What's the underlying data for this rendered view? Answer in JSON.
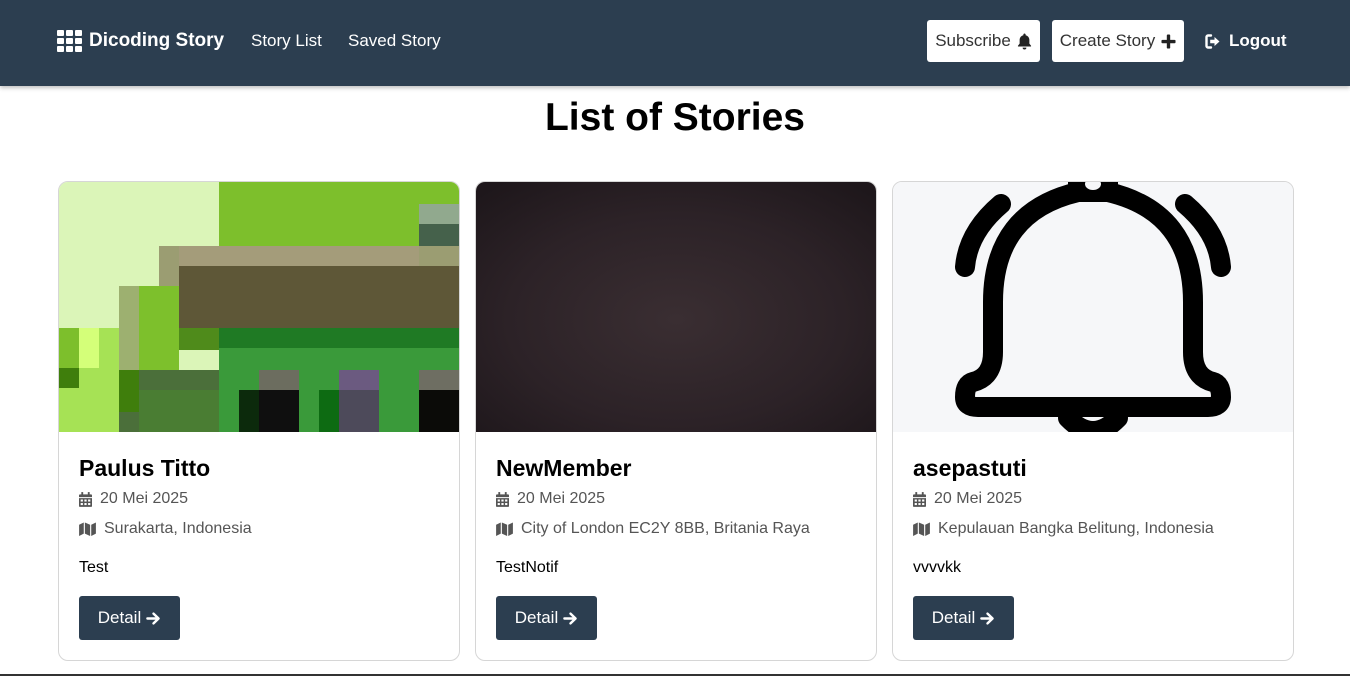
{
  "nav": {
    "brand": "Dicoding Story",
    "links": [
      "Story List",
      "Saved Story"
    ],
    "subscribe_label": "Subscribe",
    "create_label": "Create Story",
    "logout_label": "Logout",
    "background_color": "#2c3e50"
  },
  "main": {
    "title": "List of Stories"
  },
  "stories": [
    {
      "name": "Paulus Titto",
      "date": "20 Mei 2025",
      "location": "Surakarta, Indonesia",
      "description": "Test",
      "detail_label": "Detail"
    },
    {
      "name": "NewMember",
      "date": "20 Mei 2025",
      "location": "City of London EC2Y 8BB, Britania Raya",
      "description": "TestNotif",
      "detail_label": "Detail"
    },
    {
      "name": "asepastuti",
      "date": "20 Mei 2025",
      "location": "Kepulauan Bangka Belitung, Indonesia",
      "description": "vvvvkk",
      "detail_label": "Detail"
    }
  ],
  "icons": {
    "brand": "grid-icon",
    "subscribe": "bell-icon",
    "create": "plus-icon",
    "logout": "sign-out-icon",
    "date": "calendar-icon",
    "location": "map-icon",
    "detail": "arrow-right-icon"
  }
}
